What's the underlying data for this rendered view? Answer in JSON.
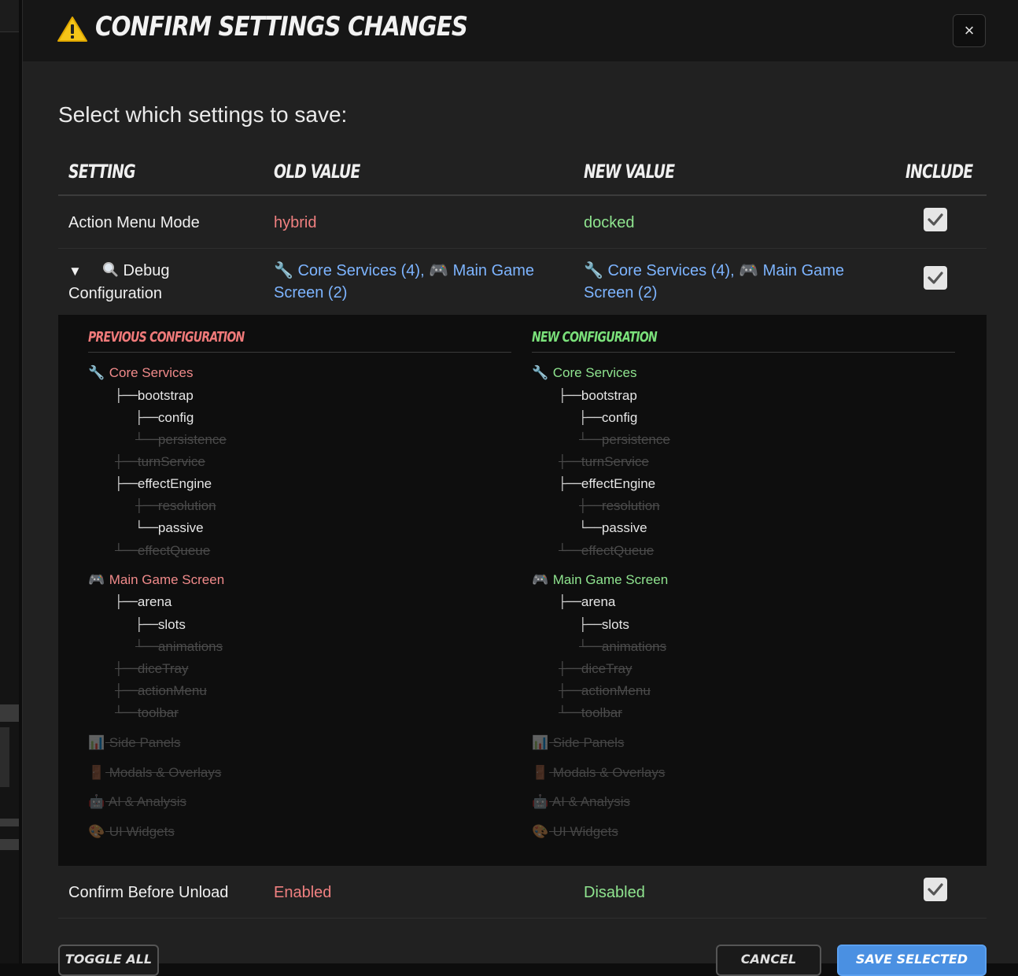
{
  "modal": {
    "title": "Confirm Settings Changes",
    "close_label": "×",
    "subtitle": "Select which settings to save:"
  },
  "table": {
    "headers": {
      "setting": "Setting",
      "old": "Old Value",
      "new": "New Value",
      "include": "Include"
    },
    "rows": [
      {
        "setting": "Action Menu Mode",
        "old": "hybrid",
        "new": "docked",
        "included": true
      },
      {
        "setting_line1": "Debug",
        "setting_line2": "Configuration",
        "expand_icon": "▼",
        "old_line1_a": "Core Services (4),",
        "old_line1_b": "Main Game",
        "old_line2": "Screen (2)",
        "new_line1_a": "Core Services (4),",
        "new_line1_b": "Main Game",
        "new_line2": "Screen (2)",
        "included": true
      },
      {
        "setting": "Confirm Before Unload",
        "old": "Enabled",
        "new": "Disabled",
        "included": true
      }
    ]
  },
  "detail": {
    "previous_title": "Previous Configuration",
    "new_title": "New Configuration",
    "sections": [
      {
        "icon": "wrench-icon",
        "name": "Core Services",
        "enabled": true
      },
      {
        "icon": "gamepad-icon",
        "name": "Main Game Screen",
        "enabled": true
      },
      {
        "icon": "bar-chart-icon",
        "name": "Side Panels",
        "enabled": false
      },
      {
        "icon": "door-icon",
        "name": "Modals & Overlays",
        "enabled": false
      },
      {
        "icon": "robot-icon",
        "name": "AI & Analysis",
        "enabled": false
      },
      {
        "icon": "palette-icon",
        "name": "UI Widgets",
        "enabled": false
      }
    ],
    "tree": [
      {
        "branch": "├──",
        "label": "bootstrap",
        "enabled": true
      },
      {
        "branch": "├──",
        "label": "config",
        "enabled": true
      },
      {
        "branch": "└──",
        "label": "persistence",
        "enabled": false
      },
      {
        "branch": "├──",
        "label": "turnService",
        "enabled": false
      },
      {
        "branch": "├──",
        "label": "effectEngine",
        "enabled": true
      },
      {
        "branch": "├──",
        "label": "resolution",
        "enabled": false
      },
      {
        "branch": "└──",
        "label": "passive",
        "enabled": true
      },
      {
        "branch": "└──",
        "label": "effectQueue",
        "enabled": false
      },
      {
        "branch": "├──",
        "label": "arena",
        "enabled": true
      },
      {
        "branch": "├──",
        "label": "slots",
        "enabled": true
      },
      {
        "branch": "└──",
        "label": "animations",
        "enabled": false
      },
      {
        "branch": "├──",
        "label": "diceTray",
        "enabled": false
      },
      {
        "branch": "├──",
        "label": "actionMenu",
        "enabled": false
      },
      {
        "branch": "└──",
        "label": "toolbar",
        "enabled": false
      }
    ]
  },
  "footer": {
    "toggle_all": "Toggle All",
    "cancel": "Cancel",
    "save_selected": "Save Selected"
  },
  "colors": {
    "old": "#f08080",
    "new": "#8fe48f",
    "link": "#7db4ff",
    "primary_button": "#4a90e2"
  }
}
